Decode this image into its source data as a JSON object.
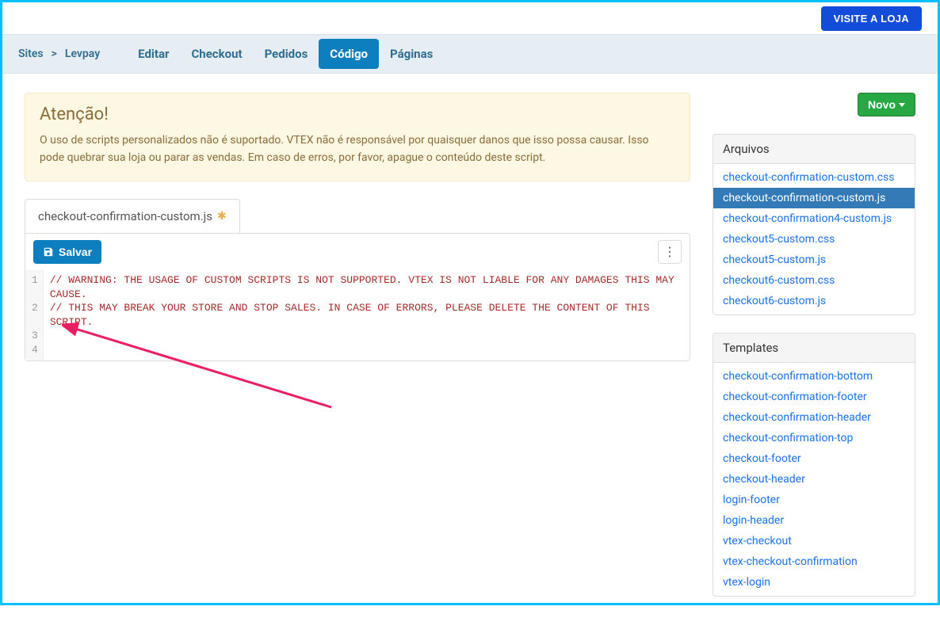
{
  "topbar": {
    "visit_store": "VISITE A LOJA"
  },
  "breadcrumb": {
    "root": "Sites",
    "site": "Levpay"
  },
  "nav": {
    "items": [
      {
        "label": "Editar",
        "active": false
      },
      {
        "label": "Checkout",
        "active": false
      },
      {
        "label": "Pedidos",
        "active": false
      },
      {
        "label": "Código",
        "active": true
      },
      {
        "label": "Páginas",
        "active": false
      }
    ]
  },
  "alert": {
    "title": "Atenção!",
    "body": "O uso de scripts personalizados não é suportado. VTEX não é responsável por quaisquer danos que isso possa causar. Isso pode quebrar sua loja ou parar as vendas. Em caso de erros, por favor, apague o conteúdo deste script."
  },
  "filetab": {
    "name": "checkout-confirmation-custom.js",
    "modified": true
  },
  "editor": {
    "save_label": "Salvar",
    "lines": [
      "// WARNING: THE USAGE OF CUSTOM SCRIPTS IS NOT SUPPORTED. VTEX IS NOT LIABLE FOR ANY DAMAGES THIS MAY CAUSE.",
      "// THIS MAY BREAK YOUR STORE AND STOP SALES. IN CASE OF ERRORS, PLEASE DELETE THE CONTENT OF THIS SCRIPT.",
      "",
      ""
    ]
  },
  "sidebar": {
    "novo_label": "Novo",
    "arquivos_title": "Arquivos",
    "templates_title": "Templates",
    "arquivos": [
      {
        "name": "checkout-confirmation-custom.css",
        "selected": false
      },
      {
        "name": "checkout-confirmation-custom.js",
        "selected": true
      },
      {
        "name": "checkout-confirmation4-custom.js",
        "selected": false
      },
      {
        "name": "checkout5-custom.css",
        "selected": false
      },
      {
        "name": "checkout5-custom.js",
        "selected": false
      },
      {
        "name": "checkout6-custom.css",
        "selected": false
      },
      {
        "name": "checkout6-custom.js",
        "selected": false
      }
    ],
    "templates": [
      {
        "name": "checkout-confirmation-bottom"
      },
      {
        "name": "checkout-confirmation-footer"
      },
      {
        "name": "checkout-confirmation-header"
      },
      {
        "name": "checkout-confirmation-top"
      },
      {
        "name": "checkout-footer"
      },
      {
        "name": "checkout-header"
      },
      {
        "name": "login-footer"
      },
      {
        "name": "login-header"
      },
      {
        "name": "vtex-checkout"
      },
      {
        "name": "vtex-checkout-confirmation"
      },
      {
        "name": "vtex-login"
      }
    ]
  }
}
